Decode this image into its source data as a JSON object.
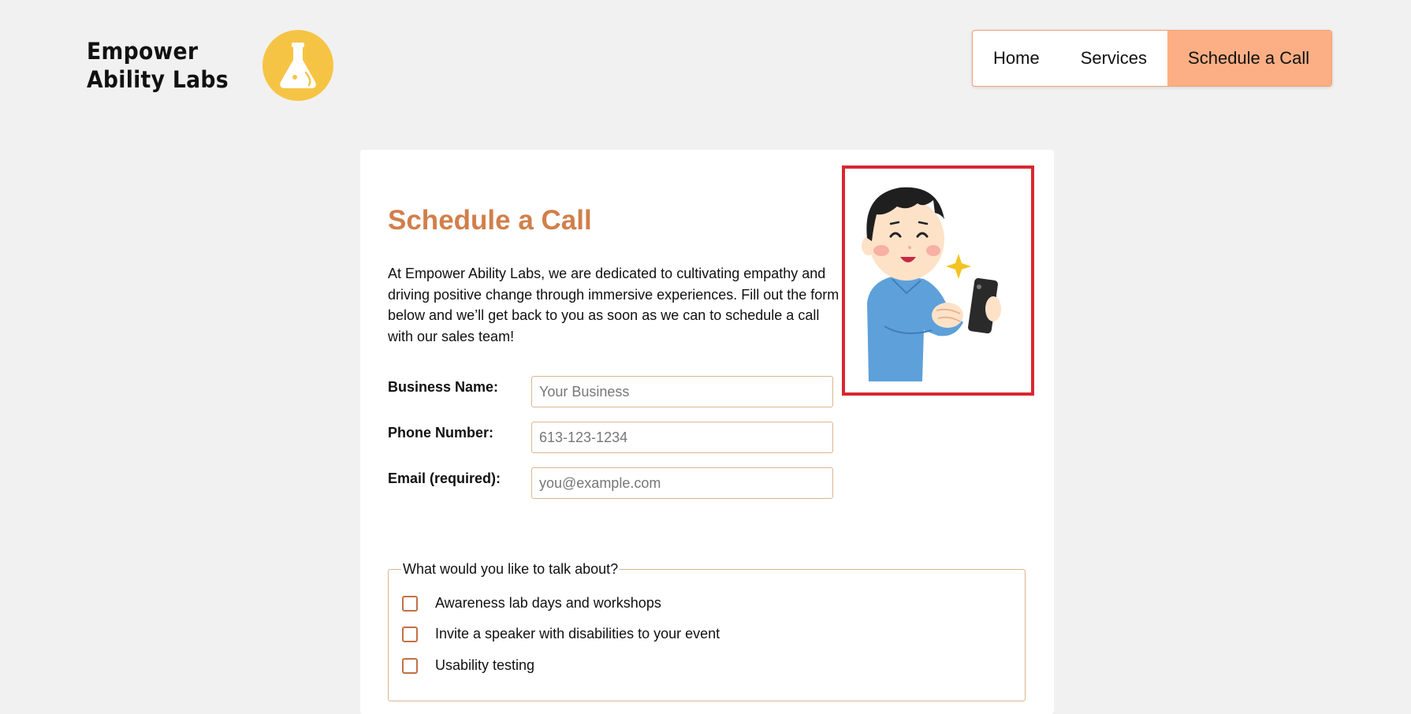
{
  "brand": {
    "name": "Empower Ability Labs",
    "logo_icon": "flask-icon"
  },
  "colors": {
    "accent": "#fcaf84",
    "logo_circle": "#f6c445",
    "title": "#d17f4b",
    "field_border": "#dcb48f",
    "checkbox_border": "#c47045",
    "image_border": "#d9262f"
  },
  "nav": {
    "items": [
      {
        "label": "Home"
      },
      {
        "label": "Services"
      },
      {
        "label": "Schedule a Call",
        "active": true
      }
    ]
  },
  "main": {
    "title": "Schedule a Call",
    "intro": "At Empower Ability Labs, we are dedicated to cultivating empathy and driving positive change through immersive experiences. Fill out the form below and we’ll get back to you as soon as we can to schedule a call with our sales team!",
    "illustration_icon": "person-with-phone-icon",
    "form": {
      "business_name": {
        "label": "Business Name:",
        "placeholder": "Your Business",
        "value": ""
      },
      "phone": {
        "label": "Phone Number:",
        "placeholder": "613-123-1234",
        "value": ""
      },
      "email": {
        "label": "Email (required):",
        "placeholder": "you@example.com",
        "value": ""
      }
    },
    "topics": {
      "legend": "What would you like to talk about?",
      "options": [
        {
          "label": "Awareness lab days and workshops",
          "checked": false
        },
        {
          "label": "Invite a speaker with disabilities to your event",
          "checked": false
        },
        {
          "label": "Usability testing",
          "checked": false
        }
      ]
    }
  }
}
